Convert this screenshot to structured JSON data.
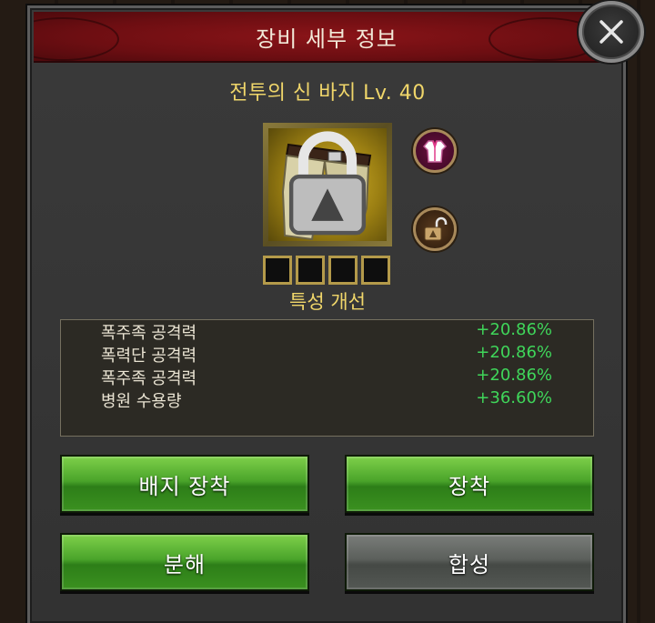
{
  "dialog": {
    "title": "장비 세부 정보"
  },
  "item": {
    "name": "전투의 신 바지  Lv. 40",
    "icon": "cargo-pants-icon",
    "slots_count": 4
  },
  "trait": {
    "label": "특성 개선"
  },
  "stats": [
    {
      "name": "폭주족 공격력",
      "value": "+20.86%"
    },
    {
      "name": "폭력단 공격력",
      "value": "+20.86%"
    },
    {
      "name": "폭주족 공격력",
      "value": "+20.86%"
    },
    {
      "name": "병원 수용량",
      "value": "+36.60%"
    }
  ],
  "buttons": {
    "badge_equip": "배지 장착",
    "equip": "장착",
    "dismantle": "분해",
    "combine": "합성"
  },
  "icons": {
    "close": "close-icon",
    "costume": "costume-icon",
    "unlock": "unlock-icon",
    "lock": "lock-icon"
  },
  "colors": {
    "header": "#7a1015",
    "title": "#f0d66a",
    "stat_value": "#3fd65a",
    "button_green": "#4aa42a",
    "button_gray": "#5b5f5b"
  }
}
